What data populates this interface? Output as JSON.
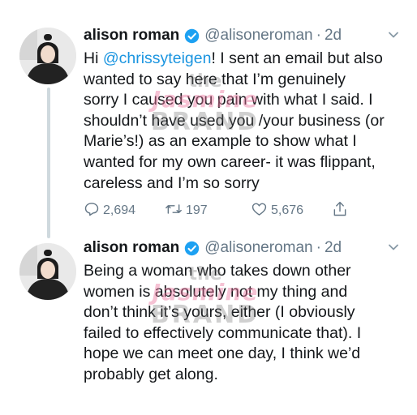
{
  "tweets": [
    {
      "author_name": "alison roman",
      "handle": "@alisoneroman",
      "separator": "·",
      "time": "2d",
      "text_lines": [
        {
          "pre": "Hi ",
          "mention": "@chrissyteigen",
          "post": "! I sent an email but also"
        },
        {
          "pre": "wanted to say here that I’m genuinely",
          "mention": "",
          "post": ""
        },
        {
          "pre": "sorry I caused you pain with what I said. I",
          "mention": "",
          "post": ""
        },
        {
          "pre": "shouldn’t have used you /your business (or",
          "mention": "",
          "post": ""
        },
        {
          "pre": "Marie’s!) as an example to show what I",
          "mention": "",
          "post": ""
        },
        {
          "pre": "wanted for my own career- it was flippant,",
          "mention": "",
          "post": ""
        },
        {
          "pre": "careless and I’m so sorry",
          "mention": "",
          "post": ""
        }
      ],
      "replies": "2,694",
      "retweets": "197",
      "likes": "5,676"
    },
    {
      "author_name": "alison roman",
      "handle": "@alisoneroman",
      "separator": "·",
      "time": "2d",
      "text_lines": [
        "Being a woman who takes down other",
        "women is absolutely not my thing and",
        "don’t think it’s yours, either (I obviously",
        "failed to effectively communicate that). I",
        "hope we can meet one day, I think we’d",
        "probably get along."
      ]
    }
  ],
  "watermark": {
    "the": "the",
    "jasmine": "Jasmine",
    "brand": "BRAND"
  },
  "icons": {
    "verified": "verified-badge-icon",
    "reply": "reply-icon",
    "retweet": "retweet-icon",
    "like": "heart-icon",
    "share": "share-icon",
    "more": "chevron-down-icon"
  },
  "colors": {
    "link": "#1b95e0",
    "verified": "#1da1f2",
    "secondary_text": "#657786",
    "thread_line": "#cfd9de"
  }
}
